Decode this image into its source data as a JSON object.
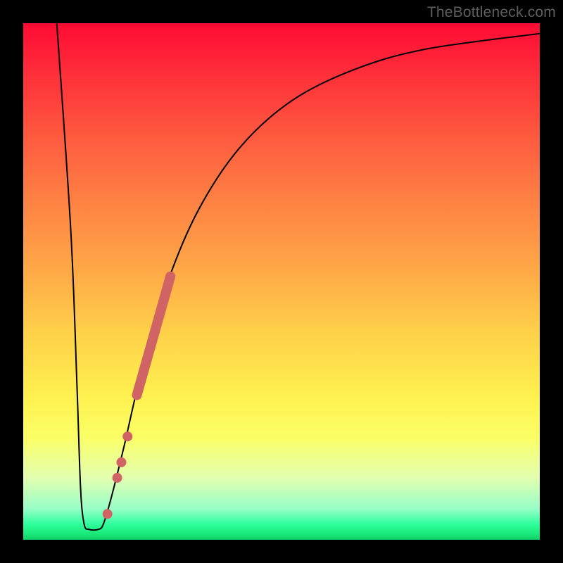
{
  "watermark": "TheBottleneck.com",
  "chart_data": {
    "type": "line",
    "title": "",
    "xlabel": "",
    "ylabel": "",
    "xlim": [
      0,
      100
    ],
    "ylim": [
      0,
      100
    ],
    "series": [
      {
        "name": "bottleneck-curve",
        "points": [
          {
            "x": 6.5,
            "y": 100
          },
          {
            "x": 9.2,
            "y": 60
          },
          {
            "x": 10.4,
            "y": 30
          },
          {
            "x": 11.1,
            "y": 10
          },
          {
            "x": 11.8,
            "y": 3
          },
          {
            "x": 12.8,
            "y": 2
          },
          {
            "x": 14.5,
            "y": 2
          },
          {
            "x": 15.5,
            "y": 3
          },
          {
            "x": 17.0,
            "y": 8
          },
          {
            "x": 19.5,
            "y": 18
          },
          {
            "x": 23.0,
            "y": 33
          },
          {
            "x": 28.0,
            "y": 50
          },
          {
            "x": 34.0,
            "y": 64
          },
          {
            "x": 42.0,
            "y": 76
          },
          {
            "x": 52.0,
            "y": 85
          },
          {
            "x": 64.0,
            "y": 91
          },
          {
            "x": 78.0,
            "y": 95
          },
          {
            "x": 100.0,
            "y": 98
          }
        ]
      }
    ],
    "highlight_segment": {
      "name": "highlighted-range",
      "start": {
        "x": 22.0,
        "y": 28
      },
      "end": {
        "x": 28.5,
        "y": 51
      }
    },
    "markers": [
      {
        "x": 16.3,
        "y": 5
      },
      {
        "x": 18.2,
        "y": 12
      },
      {
        "x": 19.0,
        "y": 15
      },
      {
        "x": 20.2,
        "y": 20
      }
    ]
  },
  "colors": {
    "curve": "#000000",
    "highlight": "#d06464",
    "frame": "#000000"
  }
}
